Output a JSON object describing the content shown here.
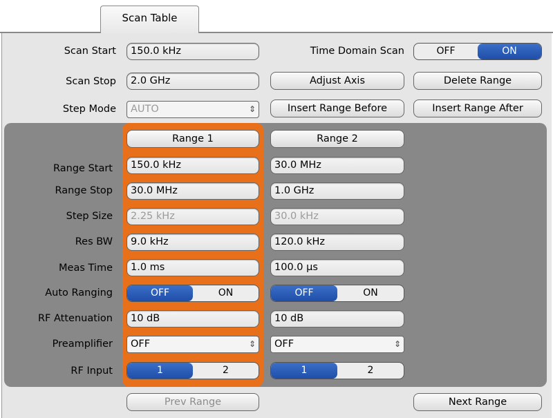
{
  "tab": {
    "label": "Scan Table"
  },
  "scan": {
    "start_label": "Scan Start",
    "start_value": "150.0 kHz",
    "stop_label": "Scan Stop",
    "stop_value": "2.0 GHz",
    "step_mode_label": "Step Mode",
    "step_mode_value": "AUTO",
    "time_domain_label": "Time Domain Scan",
    "time_domain_off": "OFF",
    "time_domain_on": "ON"
  },
  "buttons": {
    "adjust_axis": "Adjust Axis",
    "delete_range": "Delete Range",
    "insert_before": "Insert Range Before",
    "insert_after": "Insert Range After",
    "prev_range": "Prev Range",
    "next_range": "Next Range"
  },
  "row_labels": {
    "range_start": "Range Start",
    "range_stop": "Range Stop",
    "step_size": "Step Size",
    "res_bw": "Res BW",
    "meas_time": "Meas Time",
    "auto_ranging": "Auto Ranging",
    "rf_attenuation": "RF Attenuation",
    "preamplifier": "Preamplifier",
    "rf_input": "RF Input"
  },
  "ranges": [
    {
      "title": "Range 1",
      "start": "150.0 kHz",
      "stop": "30.0 MHz",
      "step": "2.25 kHz",
      "res_bw": "9.0 kHz",
      "meas_time": "1.0 ms",
      "auto_off": "OFF",
      "auto_on": "ON",
      "atten": "10 dB",
      "preamp": "OFF",
      "input_1": "1",
      "input_2": "2"
    },
    {
      "title": "Range 2",
      "start": "30.0 MHz",
      "stop": "1.0 GHz",
      "step": "30.0 kHz",
      "res_bw": "120.0 kHz",
      "meas_time": "100.0 µs",
      "auto_off": "OFF",
      "auto_on": "ON",
      "atten": "10 dB",
      "preamp": "OFF",
      "input_1": "1",
      "input_2": "2"
    }
  ],
  "colors": {
    "selected_range": "#e8701a",
    "toggle_on": "#1f4ea8",
    "group_bg": "#888888"
  }
}
